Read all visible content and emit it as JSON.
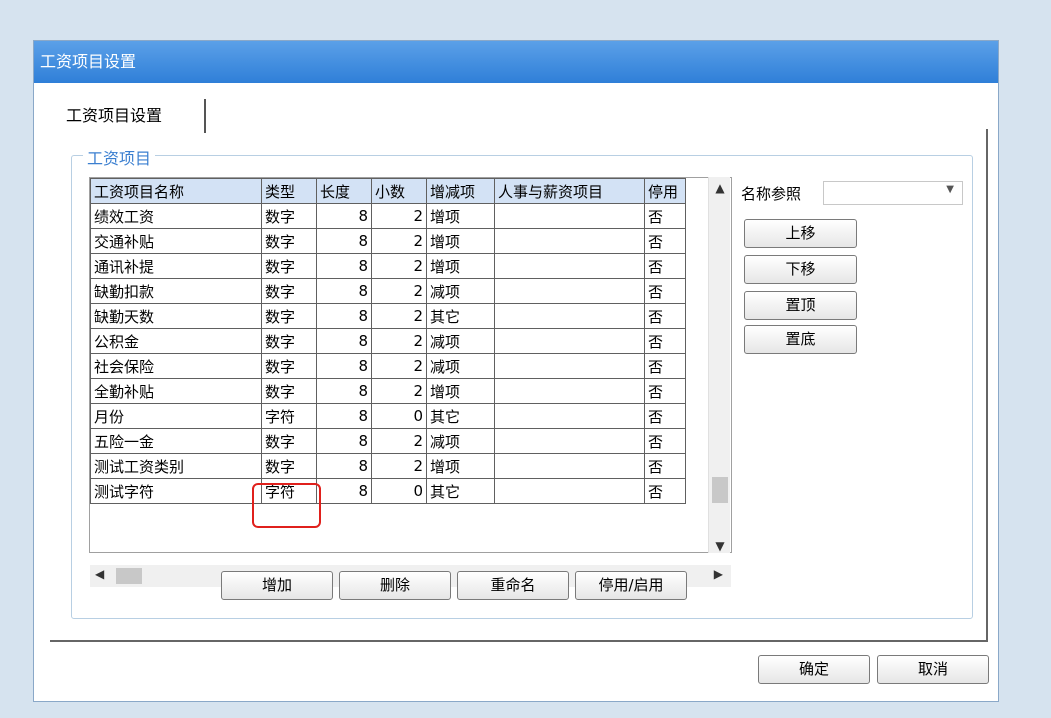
{
  "window": {
    "title": "工资项目设置"
  },
  "tab": {
    "label": "工资项目设置"
  },
  "group": {
    "label": "工资项目"
  },
  "table": {
    "headers": [
      "工资项目名称",
      "类型",
      "长度",
      "小数",
      "增减项",
      "人事与薪资项目",
      "停用"
    ],
    "rows": [
      [
        "绩效工资",
        "数字",
        "8",
        "2",
        "增项",
        "",
        "否"
      ],
      [
        "交通补贴",
        "数字",
        "8",
        "2",
        "增项",
        "",
        "否"
      ],
      [
        "通讯补提",
        "数字",
        "8",
        "2",
        "增项",
        "",
        "否"
      ],
      [
        "缺勤扣款",
        "数字",
        "8",
        "2",
        "减项",
        "",
        "否"
      ],
      [
        "缺勤天数",
        "数字",
        "8",
        "2",
        "其它",
        "",
        "否"
      ],
      [
        "公积金",
        "数字",
        "8",
        "2",
        "减项",
        "",
        "否"
      ],
      [
        "社会保险",
        "数字",
        "8",
        "2",
        "减项",
        "",
        "否"
      ],
      [
        "全勤补贴",
        "数字",
        "8",
        "2",
        "增项",
        "",
        "否"
      ],
      [
        "月份",
        "字符",
        "8",
        "0",
        "其它",
        "",
        "否"
      ],
      [
        "五险一金",
        "数字",
        "8",
        "2",
        "减项",
        "",
        "否"
      ],
      [
        "测试工资类别",
        "数字",
        "8",
        "2",
        "增项",
        "",
        "否"
      ],
      [
        "测试字符",
        "字符",
        "8",
        "0",
        "其它",
        "",
        "否"
      ]
    ]
  },
  "name_ref": {
    "label": "名称参照",
    "value": ""
  },
  "side_buttons": {
    "up": "上移",
    "down": "下移",
    "top": "置顶",
    "bottom": "置底"
  },
  "actions": {
    "add": "增加",
    "delete": "删除",
    "rename": "重命名",
    "toggle": "停用/启用"
  },
  "footer": {
    "ok": "确定",
    "cancel": "取消"
  },
  "scroll_icons": {
    "up": "chevron-up-icon",
    "down": "chevron-down-icon",
    "left": "chevron-left-icon",
    "right": "chevron-right-icon"
  },
  "colors": {
    "title_bar": "#3f8ee0",
    "header_bg": "#d3e2f5",
    "highlight": "#e0201c",
    "group_label": "#3b7fd0"
  }
}
